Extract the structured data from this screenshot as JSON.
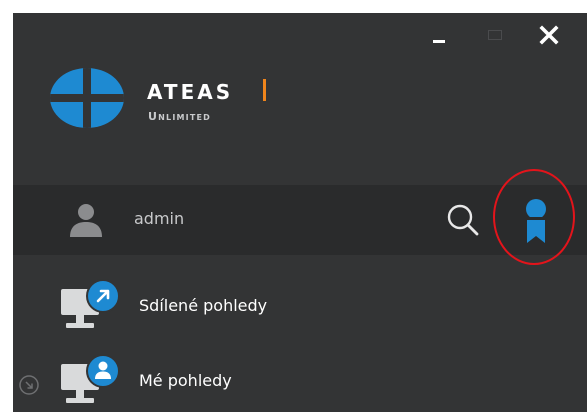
{
  "brand": {
    "name": "ATEAS",
    "subtitle": "Unlimited",
    "accent_color": "#f0851c",
    "logo_color": "#1e8ad2"
  },
  "window_controls": {
    "minimize_icon": "minimize-icon",
    "maximize_icon": "maximize-icon",
    "close_icon": "close-icon"
  },
  "user": {
    "name": "admin",
    "avatar_icon": "user-icon",
    "search_icon": "search-icon",
    "badge_icon": "award-ribbon-icon",
    "highlight_color": "#e3141b"
  },
  "list": {
    "items": [
      {
        "label": "Sdílené pohledy",
        "icon": "shared-view-icon"
      },
      {
        "label": "Mé pohledy",
        "icon": "my-view-icon",
        "expander_icon": "expand-arrow-icon"
      }
    ]
  }
}
